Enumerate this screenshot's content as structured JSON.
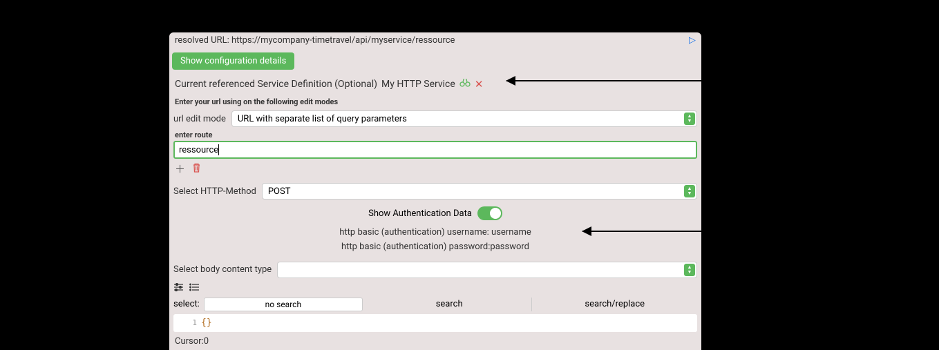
{
  "resolvedUrl": {
    "label": "resolved URL:",
    "value": "https://mycompany-timetravel/api/myservice/ressource"
  },
  "configButton": "Show configuration details",
  "serviceDef": {
    "label": "Current referenced Service Definition (Optional)",
    "name": "My HTTP Service"
  },
  "editModeHint": "Enter your url using on the following edit modes",
  "urlEditMode": {
    "label": "url edit mode",
    "selected": "URL with separate list of query parameters"
  },
  "enterRouteLabel": "enter route",
  "routeValue": "ressource",
  "httpMethod": {
    "label": "Select HTTP-Method",
    "selected": "POST"
  },
  "authToggle": {
    "label": "Show Authentication Data"
  },
  "authLines": {
    "username": "http basic (authentication) username: username",
    "password": "http basic (authentication) password:password"
  },
  "bodyType": {
    "label": "Select body content type",
    "selected": ""
  },
  "selectLabel": "select:",
  "segments": {
    "noSearch": "no search",
    "search": "search",
    "searchReplace": "search/replace"
  },
  "code": {
    "lineNum": "1",
    "content": "{}"
  },
  "cursor": {
    "label": "Cursor:",
    "value": "0"
  }
}
